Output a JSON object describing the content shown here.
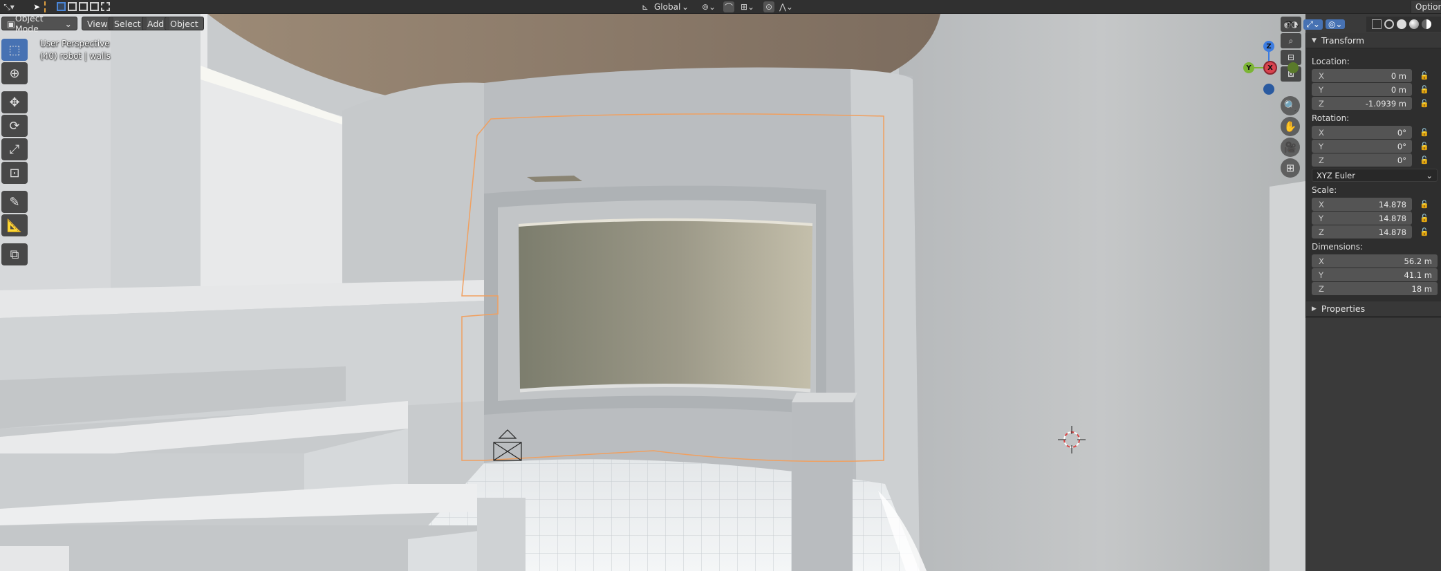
{
  "topbar": {
    "orientation_label": "Global",
    "options_label": "Options"
  },
  "viewport_header": {
    "mode_label": "Object Mode",
    "menus": [
      "View",
      "Select",
      "Add",
      "Object"
    ]
  },
  "viewport_info": {
    "view_name": "User Perspective",
    "object_info": "(40) robot | walls"
  },
  "gizmo": {
    "x": "X",
    "y": "Y",
    "z": "Z"
  },
  "npanel": {
    "transform_title": "Transform",
    "location_label": "Location:",
    "location": [
      {
        "axis": "X",
        "value": "0 m"
      },
      {
        "axis": "Y",
        "value": "0 m"
      },
      {
        "axis": "Z",
        "value": "-1.0939 m"
      }
    ],
    "rotation_label": "Rotation:",
    "rotation": [
      {
        "axis": "X",
        "value": "0°"
      },
      {
        "axis": "Y",
        "value": "0°"
      },
      {
        "axis": "Z",
        "value": "0°"
      }
    ],
    "rotation_mode": "XYZ Euler",
    "scale_label": "Scale:",
    "scale": [
      {
        "axis": "X",
        "value": "14.878"
      },
      {
        "axis": "Y",
        "value": "14.878"
      },
      {
        "axis": "Z",
        "value": "14.878"
      }
    ],
    "dimensions_label": "Dimensions:",
    "dimensions": [
      {
        "axis": "X",
        "value": "56.2 m"
      },
      {
        "axis": "Y",
        "value": "41.1 m"
      },
      {
        "axis": "Z",
        "value": "18 m"
      }
    ],
    "properties_title": "Properties"
  },
  "colors": {
    "accent": "#4772b3",
    "selection_outline": "#f0a060",
    "axis_x": "#d9434f",
    "axis_y": "#7cb535",
    "axis_z": "#3c7ce0"
  }
}
